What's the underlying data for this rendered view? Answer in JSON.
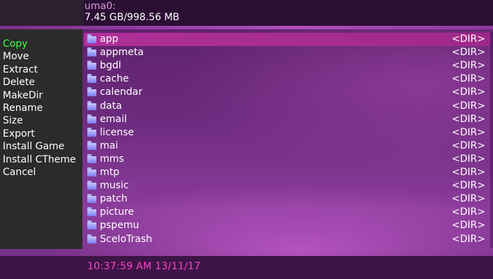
{
  "header": {
    "partition": "uma0:",
    "free_space": "7.45 GB/998.56 MB"
  },
  "context_menu": {
    "items": [
      {
        "label": "Copy",
        "selected": true
      },
      {
        "label": "Move"
      },
      {
        "label": "Extract"
      },
      {
        "label": "Delete"
      },
      {
        "label": "MakeDir"
      },
      {
        "label": "Rename"
      },
      {
        "label": "Size"
      },
      {
        "label": "Export"
      },
      {
        "label": "Install Game"
      },
      {
        "label": "Install CTheme"
      },
      {
        "label": "Cancel"
      }
    ]
  },
  "files": {
    "selected_index": 0,
    "icon": "folder-icon",
    "entries": [
      {
        "name": "app",
        "type": "<DIR>"
      },
      {
        "name": "appmeta",
        "type": "<DIR>"
      },
      {
        "name": "bgdl",
        "type": "<DIR>"
      },
      {
        "name": "cache",
        "type": "<DIR>"
      },
      {
        "name": "calendar",
        "type": "<DIR>"
      },
      {
        "name": "data",
        "type": "<DIR>"
      },
      {
        "name": "email",
        "type": "<DIR>"
      },
      {
        "name": "license",
        "type": "<DIR>"
      },
      {
        "name": "mai",
        "type": "<DIR>"
      },
      {
        "name": "mms",
        "type": "<DIR>"
      },
      {
        "name": "mtp",
        "type": "<DIR>"
      },
      {
        "name": "music",
        "type": "<DIR>"
      },
      {
        "name": "patch",
        "type": "<DIR>"
      },
      {
        "name": "picture",
        "type": "<DIR>"
      },
      {
        "name": "pspemu",
        "type": "<DIR>"
      },
      {
        "name": "SceIoTrash",
        "type": "<DIR>"
      }
    ]
  },
  "status_bar": {
    "time": "10:37:59 AM",
    "date": "13/11/17"
  },
  "colors": {
    "menu_selected": "#44ff44",
    "clock": "#ff44cc",
    "partition_label": "#d89ad8",
    "folder_icon": "#8f8ff5"
  }
}
